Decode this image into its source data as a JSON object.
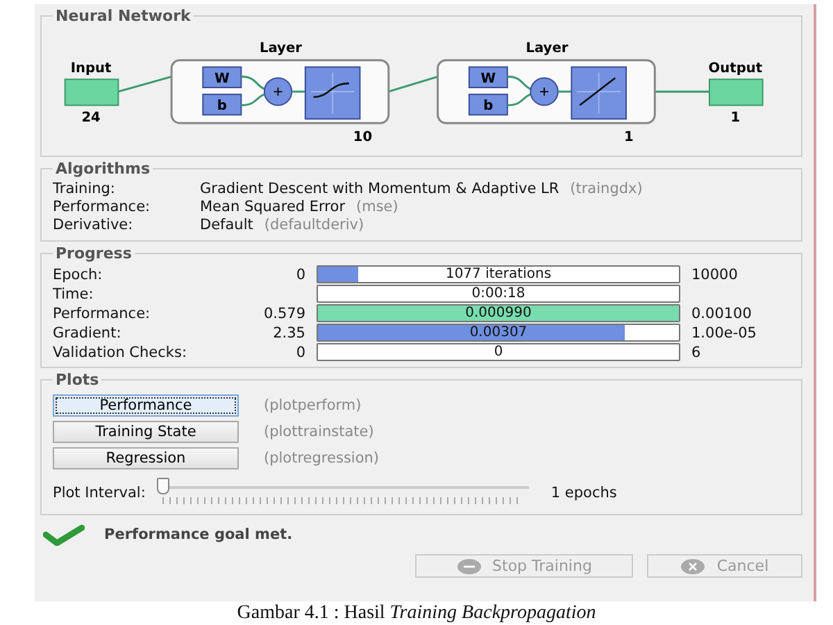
{
  "network": {
    "title": "Neural Network",
    "input": {
      "label": "Input",
      "size": "24"
    },
    "layers": [
      {
        "title": "Layer",
        "weight": "W",
        "bias": "b",
        "size": "10",
        "kind": "sigmoid"
      },
      {
        "title": "Layer",
        "weight": "W",
        "bias": "b",
        "size": "1",
        "kind": "linear"
      }
    ],
    "output": {
      "label": "Output",
      "size": "1"
    }
  },
  "algorithms": {
    "title": "Algorithms",
    "rows": [
      {
        "label": "Training:",
        "value": "Gradient Descent with Momentum & Adaptive LR",
        "function": "(traingdx)"
      },
      {
        "label": "Performance:",
        "value": "Mean Squared Error",
        "function": "(mse)"
      },
      {
        "label": "Derivative:",
        "value": "Default",
        "function": "(defaultderiv)"
      }
    ]
  },
  "progress": {
    "title": "Progress",
    "rows": [
      {
        "label": "Epoch:",
        "start": "0",
        "value": "1077 iterations",
        "end": "10000",
        "level": 0.11,
        "kind": "count"
      },
      {
        "label": "Time:",
        "value": "0:00:18"
      },
      {
        "label": "Performance:",
        "start": "0.579",
        "value": "0.000990",
        "end": "0.00100",
        "level": 1,
        "kind": "goal"
      },
      {
        "label": "Gradient:",
        "start": "2.35",
        "value": "0.00307",
        "end": "1.00e-05",
        "level": 0.85,
        "kind": "count"
      },
      {
        "label": "Validation Checks:",
        "start": "0",
        "value": "0",
        "end": "6"
      }
    ]
  },
  "plots": {
    "title": "Plots",
    "buttons": [
      {
        "label": "Performance",
        "function": "(plotperform)",
        "focused": true
      },
      {
        "label": "Training State",
        "function": "(plottrainstate)",
        "focused": false
      },
      {
        "label": "Regression",
        "function": "(plotregression)",
        "focused": false
      }
    ],
    "interval": {
      "label": "Plot Interval:",
      "level": 0,
      "reading": "1 epochs"
    }
  },
  "status": {
    "text": "Performance goal met."
  },
  "buttons": [
    {
      "label": "Stop Training",
      "kind": "stop",
      "disabled": true
    },
    {
      "label": "Cancel",
      "kind": "cancel",
      "disabled": true
    }
  ],
  "caption": "Gambar 4.1 : Hasil *Training* *Backpropagation*"
}
